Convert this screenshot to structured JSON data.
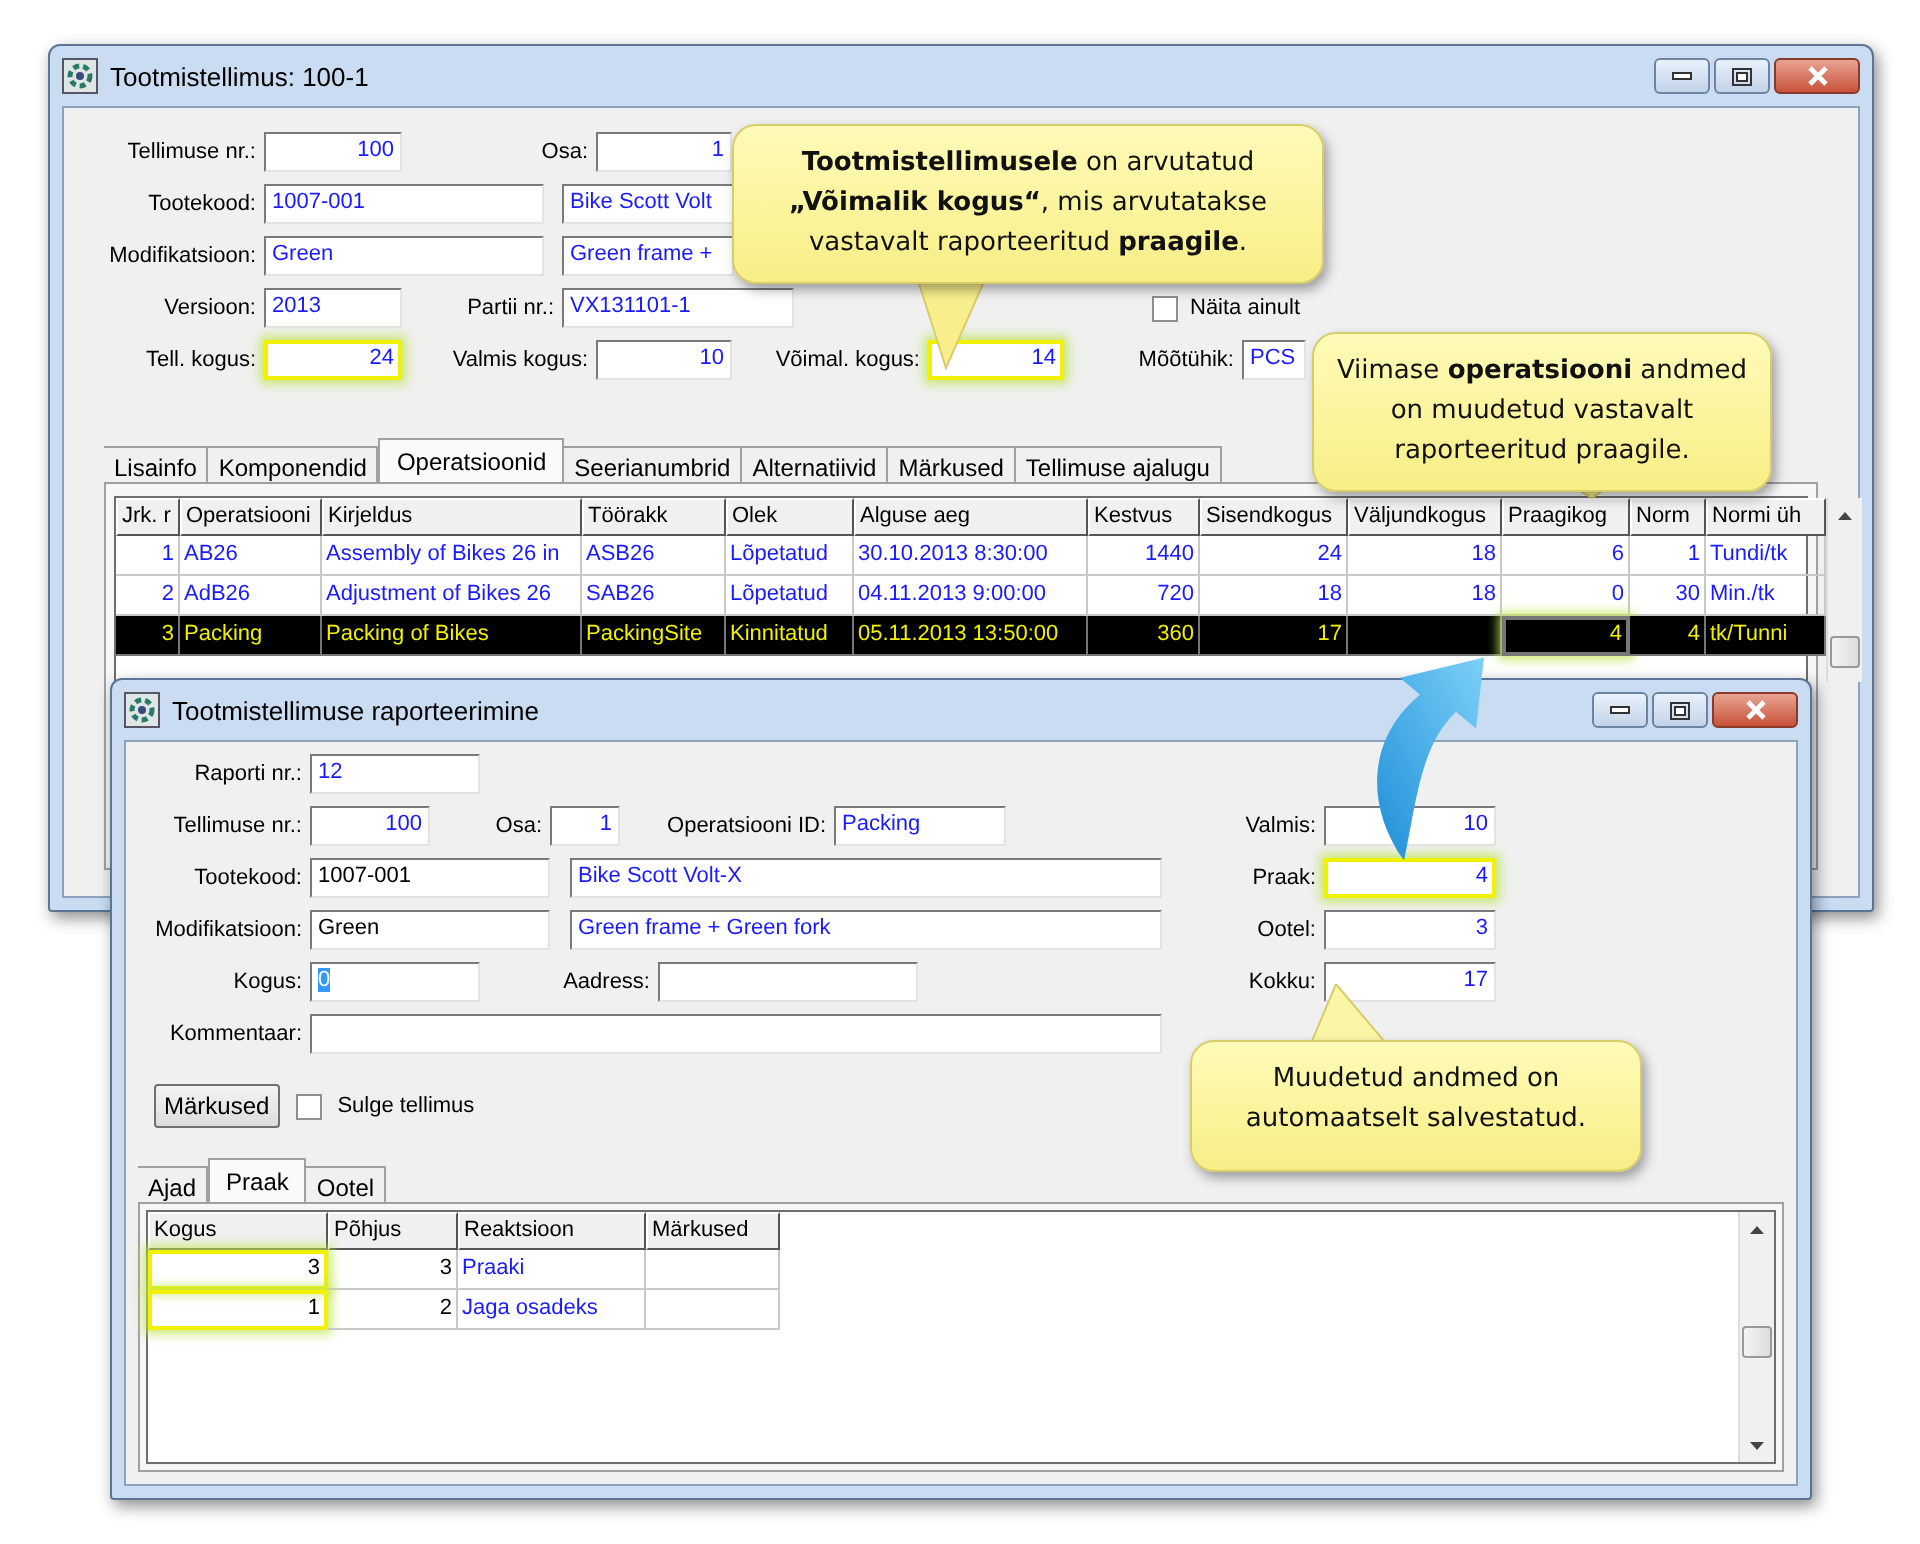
{
  "main_window": {
    "title": "Tootmistellimus: 100-1",
    "form": [
      [
        {
          "label": "Tellimuse nr.:",
          "value": "100",
          "kind": "value",
          "highlighted": false
        },
        {
          "label": "Osa:",
          "value": "1",
          "kind": "value",
          "highlighted": false
        }
      ],
      [
        {
          "label": "Tootekood:",
          "value": "1007-001",
          "kind": "value",
          "highlighted": false
        },
        {
          "value": "Bike Scott Volt",
          "kind": "value",
          "highlighted": false
        }
      ],
      [
        {
          "label": "Modifikatsioon:",
          "value": "Green",
          "kind": "value",
          "highlighted": false
        },
        {
          "value": "Green frame +",
          "kind": "value",
          "highlighted": false
        }
      ],
      [
        {
          "label": "Versioon:",
          "value": "2013",
          "kind": "value",
          "highlighted": false
        },
        {
          "label": "Partii nr.:",
          "value": "VX131101-1",
          "kind": "value",
          "highlighted": false
        },
        {
          "label": "Näita ainult",
          "kind": "checkbox",
          "checked": false
        }
      ],
      [
        {
          "label": "Tell. kogus:",
          "value": "24",
          "kind": "value",
          "highlighted": true
        },
        {
          "label": "Valmis kogus:",
          "value": "10",
          "kind": "value",
          "highlighted": false
        },
        {
          "label": "Võimal. kogus:",
          "value": "14",
          "kind": "value",
          "highlighted": true
        },
        {
          "label": "Mõõtühik:",
          "value": "PCS",
          "kind": "value",
          "highlighted": false
        }
      ]
    ],
    "tabs": [
      {
        "label": "Lisainfo",
        "selected": false
      },
      {
        "label": "Komponendid",
        "selected": false
      },
      {
        "label": "Operatsioonid",
        "selected": true
      },
      {
        "label": "Seerianumbrid",
        "selected": false
      },
      {
        "label": "Alternatiivid",
        "selected": false
      },
      {
        "label": "Märkused",
        "selected": false
      },
      {
        "label": "Tellimuse ajalugu",
        "selected": false
      }
    ],
    "table": {
      "columns": [
        "Jrk. r",
        "Operatsiooni",
        "Kirjeldus",
        "Töörakk",
        "Olek",
        "Alguse aeg",
        "Kestvus",
        "Sisendkogus",
        "Väljundkogus",
        "Praagikog",
        "Norm",
        "Normi üh"
      ],
      "rows": [
        {
          "selected": false,
          "cells": [
            "1",
            "AB26",
            "Assembly of Bikes 26 in",
            "ASB26",
            "Lõpetatud",
            "30.10.2013 8:30:00",
            "1440",
            "24",
            "18",
            "6",
            "1",
            "Tundi/tk"
          ]
        },
        {
          "selected": false,
          "cells": [
            "2",
            "AdB26",
            "Adjustment of Bikes 26",
            "SAB26",
            "Lõpetatud",
            "04.11.2013 9:00:00",
            "720",
            "18",
            "18",
            "0",
            "30",
            "Min./tk"
          ]
        },
        {
          "selected": true,
          "cells": [
            "3",
            "Packing",
            "Packing of Bikes",
            "PackingSite",
            "Kinnitatud",
            "05.11.2013 13:50:00",
            "360",
            "17",
            null,
            {
              "text": "4",
              "highlighted": true
            },
            "4",
            "tk/Tunni"
          ]
        }
      ]
    }
  },
  "report_window": {
    "title": "Tootmistellimuse raporteerimine",
    "form": [
      [
        {
          "label": "Raporti nr.:",
          "value": "12",
          "kind": "value",
          "highlighted": false
        }
      ],
      [
        {
          "label": "Tellimuse nr.:",
          "value": "100",
          "kind": "value",
          "highlighted": false
        },
        {
          "label": "Osa:",
          "value": "1",
          "kind": "value",
          "highlighted": false
        },
        {
          "label": "Operatsiooni ID:",
          "value": "Packing",
          "kind": "value",
          "highlighted": false
        },
        {
          "label": "Valmis:",
          "value": "10",
          "kind": "value",
          "highlighted": false
        }
      ],
      [
        {
          "label": "Tootekood:",
          "value": "1007-001",
          "kind": "input",
          "highlighted": false
        },
        {
          "value": "Bike Scott Volt-X",
          "kind": "value",
          "highlighted": false
        },
        {
          "label": "Praak:",
          "value": "4",
          "kind": "value",
          "highlighted": true
        }
      ],
      [
        {
          "label": "Modifikatsioon:",
          "value": "Green",
          "kind": "input",
          "highlighted": false
        },
        {
          "value": "Green frame + Green fork",
          "kind": "value",
          "highlighted": false
        },
        {
          "label": "Ootel:",
          "value": "3",
          "kind": "value",
          "highlighted": false
        }
      ],
      [
        {
          "label": "Kogus:",
          "value": "0",
          "kind": "input-selected",
          "highlighted": false
        },
        {
          "label": "Aadress:",
          "kind": "input",
          "highlighted": false
        },
        {
          "label": "Kokku:",
          "value": "17",
          "kind": "value",
          "highlighted": false
        }
      ],
      [
        {
          "label": "Kommentaar:",
          "kind": "input",
          "highlighted": false
        }
      ]
    ],
    "notes_button": "Märkused",
    "close_order": {
      "label": "Sulge tellimus",
      "checked": false
    },
    "tabs": [
      {
        "label": "Ajad",
        "selected": false
      },
      {
        "label": "Praak",
        "selected": true
      },
      {
        "label": "Ootel",
        "selected": false
      }
    ],
    "table": {
      "columns": [
        "Kogus",
        "Põhjus",
        "Reaktsioon",
        "Märkused"
      ],
      "rows": [
        {
          "cells": [
            {
              "text": "3",
              "highlighted": true
            },
            "3",
            "Praaki",
            null
          ]
        },
        {
          "cells": [
            {
              "text": "1",
              "highlighted": true
            },
            "2",
            "Jaga osadeks",
            null
          ]
        }
      ]
    }
  },
  "callouts": [
    "**Tootmistellimusele** on arvutatud\n**„Võimalik kogus“**, mis arvutatakse\nvastavalt raporteeritud **praagile**.",
    "Viimase **operatsiooni** andmed\non muudetud vastavalt\nraporteeritud praagile.",
    "Muudetud andmed on\nautomaatselt salvestatud."
  ]
}
